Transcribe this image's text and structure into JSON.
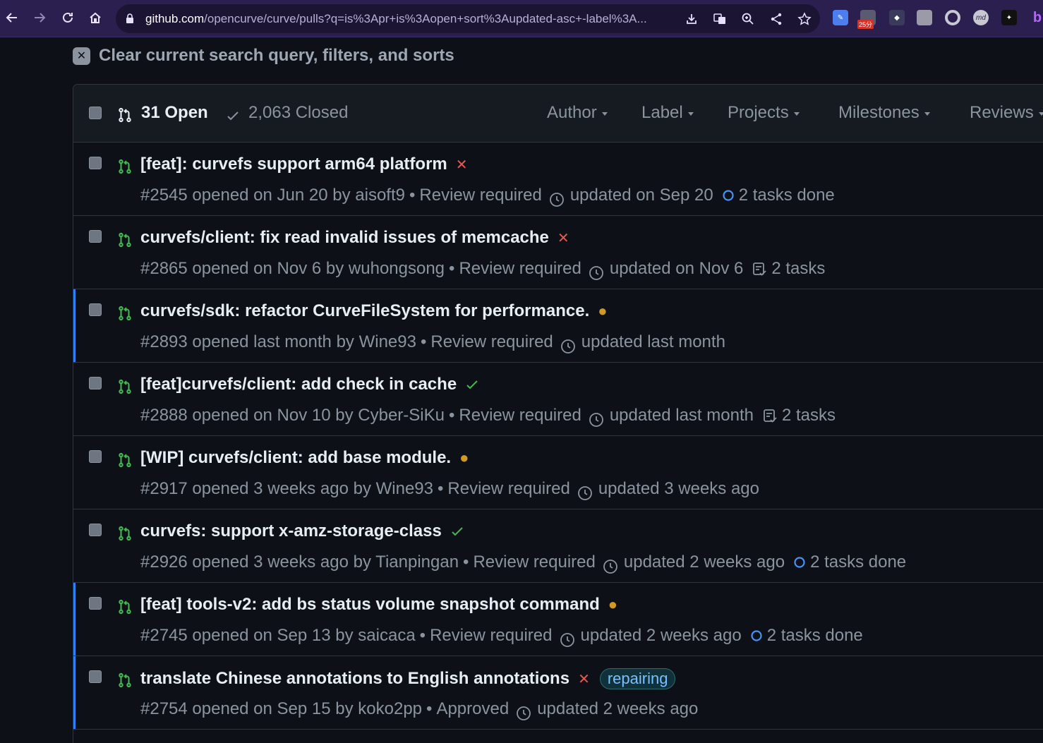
{
  "browser": {
    "url_host": "github.com",
    "url_path": "/opencurve/curve/pulls?q=is%3Apr+is%3Aopen+sort%3Aupdated-asc+-label%3A...",
    "ext_badge": "25分",
    "ext_md": "md"
  },
  "clear": {
    "label": "Clear current search query, filters, and sorts"
  },
  "header": {
    "open": "31 Open",
    "closed": "2,063 Closed",
    "filters": [
      "Author",
      "Label",
      "Projects",
      "Milestones",
      "Reviews"
    ]
  },
  "prs": [
    {
      "title": "[feat]: curvefs support arm64 platform",
      "status": "fail",
      "number": "#2545",
      "opened": "opened on Jun 20 by aisoft9",
      "review": "Review required",
      "updated": "updated on Sep 20",
      "tasks": "2 tasks done",
      "tasks_kind": "done",
      "label": "",
      "selected": false
    },
    {
      "title": "curvefs/client: fix read invalid issues of memcache",
      "status": "fail",
      "number": "#2865",
      "opened": "opened on Nov 6 by wuhongsong",
      "review": "Review required",
      "updated": "updated on Nov 6",
      "tasks": "2 tasks",
      "tasks_kind": "list",
      "label": "",
      "selected": false
    },
    {
      "title": "curvefs/sdk: refactor CurveFileSystem for performance.",
      "status": "pending",
      "number": "#2893",
      "opened": "opened last month by Wine93",
      "review": "Review required",
      "updated": "updated last month",
      "tasks": "",
      "tasks_kind": "",
      "label": "",
      "selected": true
    },
    {
      "title": "[feat]curvefs/client: add check in cache",
      "status": "success",
      "number": "#2888",
      "opened": "opened on Nov 10 by Cyber-SiKu",
      "review": "Review required",
      "updated": "updated last month",
      "tasks": "2 tasks",
      "tasks_kind": "list",
      "label": "",
      "selected": false
    },
    {
      "title": "[WIP] curvefs/client: add base module.",
      "status": "pending",
      "number": "#2917",
      "opened": "opened 3 weeks ago by Wine93",
      "review": "Review required",
      "updated": "updated 3 weeks ago",
      "tasks": "",
      "tasks_kind": "",
      "label": "",
      "selected": false
    },
    {
      "title": "curvefs: support x-amz-storage-class",
      "status": "success",
      "number": "#2926",
      "opened": "opened 3 weeks ago by Tianpingan",
      "review": "Review required",
      "updated": "updated 2 weeks ago",
      "tasks": "2 tasks done",
      "tasks_kind": "done",
      "label": "",
      "selected": false
    },
    {
      "title": "[feat] tools-v2: add bs status volume snapshot command",
      "status": "pending",
      "number": "#2745",
      "opened": "opened on Sep 13 by saicaca",
      "review": "Review required",
      "updated": "updated 2 weeks ago",
      "tasks": "2 tasks done",
      "tasks_kind": "done",
      "label": "",
      "selected": true
    },
    {
      "title": "translate Chinese annotations to English annotations",
      "status": "fail",
      "number": "#2754",
      "opened": "opened on Sep 15 by koko2pp",
      "review": "Approved",
      "updated": "updated 2 weeks ago",
      "tasks": "",
      "tasks_kind": "",
      "label": "repairing",
      "selected": true
    }
  ],
  "colors": {
    "pr_open": "#3fb950",
    "fail": "#f85149",
    "pending": "#d29922",
    "accent": "#2f81f7"
  }
}
